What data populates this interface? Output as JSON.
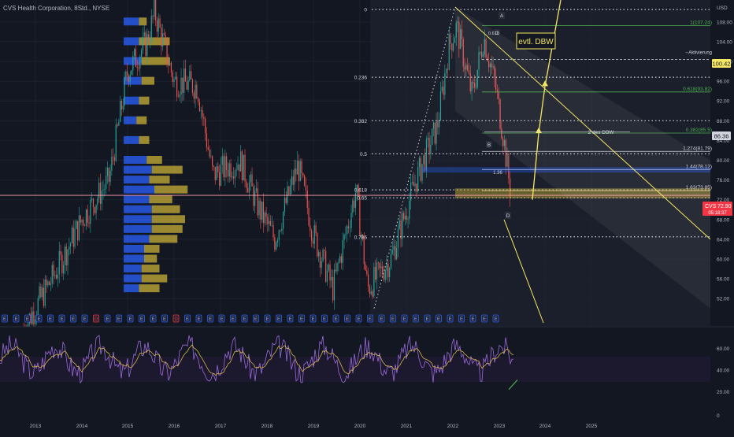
{
  "header": {
    "symbol_title": "CVS Health Corporation, 8Std., NYSE"
  },
  "price_axis": {
    "currency": "USD",
    "ticks": [
      52,
      56,
      60,
      64,
      68,
      72,
      76,
      80,
      84,
      88,
      92,
      96,
      100,
      104,
      108
    ]
  },
  "rsi_axis": {
    "ticks": [
      20,
      40,
      60
    ],
    "bottom_label": "0"
  },
  "time_axis": {
    "years": [
      "2013",
      "2014",
      "2015",
      "2016",
      "2017",
      "2018",
      "2019",
      "2020",
      "2021",
      "2022",
      "2023",
      "2024",
      "2025"
    ]
  },
  "fib_levels": [
    {
      "label": "0",
      "price": 110.5
    },
    {
      "label": "0.236",
      "price": 96.8
    },
    {
      "label": "0.382",
      "price": 88.0
    },
    {
      "label": "0.5",
      "price": 81.3
    },
    {
      "label": "0.618",
      "price": 74.0
    },
    {
      "label": "0.65",
      "price": 72.4
    },
    {
      "label": "0.786",
      "price": 64.5
    }
  ],
  "fib_ext_labels": [
    {
      "label": "1(107.24)",
      "price": 107.24,
      "color": "#4caf50"
    },
    {
      "label": "0.618(93.82)",
      "price": 93.82,
      "color": "#4caf50"
    },
    {
      "label": "0.382(85.5)",
      "price": 85.5,
      "color": "#4caf50"
    },
    {
      "label": "1.274(81.79)",
      "price": 81.79,
      "color": "#d1d4dc"
    },
    {
      "label": "1.44(78.12)",
      "price": 78.12,
      "color": "#d1d4dc"
    },
    {
      "label": "1.63(73.85)",
      "price": 73.85,
      "color": "#d1d4dc"
    }
  ],
  "annotations": {
    "dbw_label": "evtl. DBW",
    "second_dbw": "2 des DBW",
    "activation": "Aktivierung",
    "point_a": "A",
    "point_b": "B",
    "point_c": "C",
    "point_d": "D",
    "label_0618": "0.618",
    "label_136": "1.36"
  },
  "price_badges": {
    "activation_price": "100.42",
    "mid_price": "86.36",
    "ticker": "CVS",
    "last_price": "72.90",
    "countdown": "05:18:37"
  },
  "colors": {
    "background": "#131722",
    "grid": "#1e222d",
    "up_candle": "#26a69a",
    "down_candle": "#ef5350",
    "vp_blue": "#2962ff",
    "vp_yellow": "#c9b037",
    "rsi_line": "#9c6ade",
    "rsi_ma": "#d4b44a",
    "annotation_yellow": "#f5e663",
    "fib_dotted": "#d1d4dc",
    "green_line": "#4caf50",
    "last_price_red": "#f23645"
  },
  "chart_data": {
    "type": "candlestick",
    "title": "CVS Health Corporation, 8Std., NYSE",
    "xlabel": "",
    "ylabel": "USD",
    "x_range": [
      "2012-10",
      "2025-12"
    ],
    "ylim": [
      49,
      111
    ],
    "grid": true,
    "price_series_monthly_approx": [
      {
        "date": "2012-10",
        "close": 46
      },
      {
        "date": "2013-06",
        "close": 57
      },
      {
        "date": "2014-01",
        "close": 68
      },
      {
        "date": "2014-08",
        "close": 76
      },
      {
        "date": "2015-01",
        "close": 98
      },
      {
        "date": "2015-06",
        "close": 104
      },
      {
        "date": "2015-08",
        "close": 110
      },
      {
        "date": "2016-01",
        "close": 96
      },
      {
        "date": "2016-07",
        "close": 95
      },
      {
        "date": "2016-11",
        "close": 77
      },
      {
        "date": "2017-06",
        "close": 80
      },
      {
        "date": "2017-11",
        "close": 70
      },
      {
        "date": "2018-03",
        "close": 64
      },
      {
        "date": "2018-09",
        "close": 79
      },
      {
        "date": "2019-01",
        "close": 65
      },
      {
        "date": "2019-06",
        "close": 54
      },
      {
        "date": "2019-12",
        "close": 74
      },
      {
        "date": "2020-03",
        "close": 54
      },
      {
        "date": "2020-09",
        "close": 60
      },
      {
        "date": "2021-03",
        "close": 75
      },
      {
        "date": "2021-09",
        "close": 87
      },
      {
        "date": "2021-12",
        "close": 103
      },
      {
        "date": "2022-02",
        "close": 107
      },
      {
        "date": "2022-06",
        "close": 93
      },
      {
        "date": "2022-09",
        "close": 105
      },
      {
        "date": "2022-12",
        "close": 95
      },
      {
        "date": "2023-02",
        "close": 85
      },
      {
        "date": "2023-04",
        "close": 72.9
      }
    ],
    "volume_profile_relative": [
      {
        "price": 108,
        "blue": 0.3,
        "yellow": 0.15
      },
      {
        "price": 104,
        "blue": 0.3,
        "yellow": 0.6
      },
      {
        "price": 100,
        "blue": 0.35,
        "yellow": 0.55
      },
      {
        "price": 96,
        "blue": 0.35,
        "yellow": 0.25
      },
      {
        "price": 92,
        "blue": 0.3,
        "yellow": 0.2
      },
      {
        "price": 88,
        "blue": 0.25,
        "yellow": 0.2
      },
      {
        "price": 84,
        "blue": 0.3,
        "yellow": 0.2
      },
      {
        "price": 80,
        "blue": 0.45,
        "yellow": 0.3
      },
      {
        "price": 78,
        "blue": 0.55,
        "yellow": 0.6
      },
      {
        "price": 76,
        "blue": 0.5,
        "yellow": 0.4
      },
      {
        "price": 74,
        "blue": 0.6,
        "yellow": 0.65
      },
      {
        "price": 72,
        "blue": 0.5,
        "yellow": 0.45
      },
      {
        "price": 70,
        "blue": 0.55,
        "yellow": 0.55
      },
      {
        "price": 68,
        "blue": 0.55,
        "yellow": 0.65
      },
      {
        "price": 66,
        "blue": 0.55,
        "yellow": 0.6
      },
      {
        "price": 64,
        "blue": 0.5,
        "yellow": 0.55
      },
      {
        "price": 62,
        "blue": 0.4,
        "yellow": 0.3
      },
      {
        "price": 60,
        "blue": 0.4,
        "yellow": 0.25
      },
      {
        "price": 58,
        "blue": 0.35,
        "yellow": 0.35
      },
      {
        "price": 56,
        "blue": 0.35,
        "yellow": 0.5
      },
      {
        "price": 54,
        "blue": 0.3,
        "yellow": 0.4
      }
    ],
    "rsi": {
      "ylim": [
        0,
        80
      ],
      "band": [
        30,
        70
      ],
      "last_value": 38
    }
  }
}
